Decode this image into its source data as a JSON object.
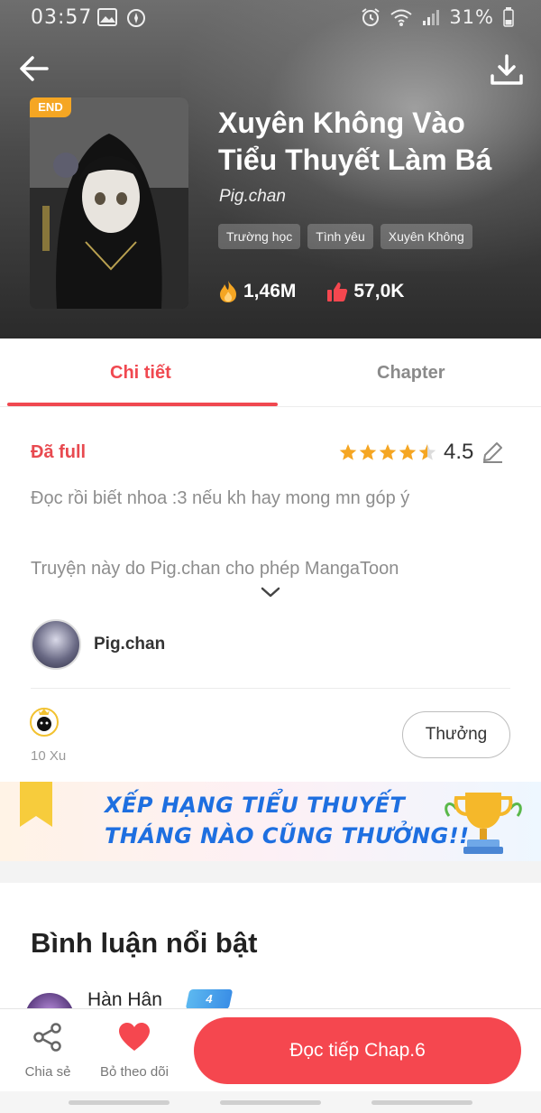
{
  "status_bar": {
    "time": "03:57",
    "battery_percent": "31%"
  },
  "book": {
    "badge": "END",
    "title": "Xuyên Không Vào Tiểu Thuyết Làm Bá",
    "author": "Pig.chan",
    "tags": [
      "Trường học",
      "Tình yêu",
      "Xuyên Không"
    ],
    "views": "1,46M",
    "likes": "57,0K"
  },
  "tabs": [
    {
      "label": "Chi tiết",
      "active": true
    },
    {
      "label": "Chapter",
      "active": false
    }
  ],
  "details": {
    "status": "Đã full",
    "rating": "4.5",
    "rating_stars": 4.5,
    "description": "Đọc rồi biết nhoa :3 nếu kh hay mong mn góp ý",
    "license_note": "Truyện này do Pig.chan cho phép MangaToon",
    "author_name": "Pig.chan",
    "xu_text": "10 Xu",
    "reward_button": "Thưởng"
  },
  "banner": {
    "line1": "XẾP HẠNG TIỂU THUYẾT",
    "line2": "THÁNG NÀO CŨNG THƯỞNG!!"
  },
  "comments": {
    "title": "Bình luận nổi bật",
    "first_commenter": "Hàn Hân",
    "first_commenter_badge": "4"
  },
  "bottom_bar": {
    "share_label": "Chia sẻ",
    "follow_label": "Bỏ theo dõi",
    "read_button": "Đọc tiếp Chap.6"
  },
  "colors": {
    "accent": "#f5474f",
    "tab_active": "#f04850",
    "star": "#f5a623",
    "banner_text": "#1e6fe0"
  }
}
